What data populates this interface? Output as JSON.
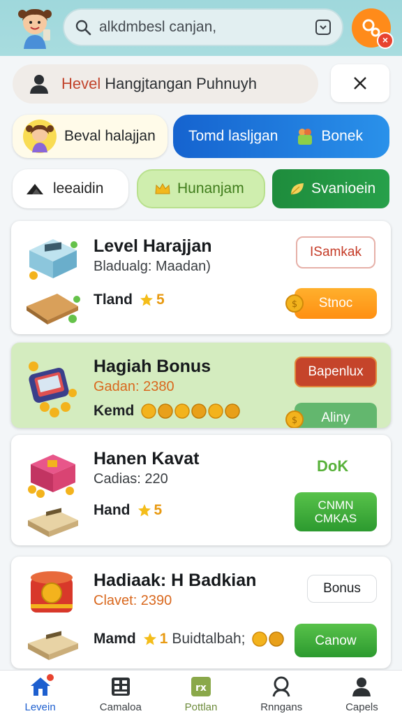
{
  "header": {
    "search_text": "alkdmbesl canjan,",
    "search_icon": "search-icon",
    "trail_icon": "tablet-icon",
    "fab_icon": "link-icon",
    "badge_icon": "close-icon"
  },
  "banner": {
    "title_highlight": "Hevel",
    "title_rest": "Hangjtangan Puhnuyh",
    "icon": "user-icon",
    "close_icon": "close-icon"
  },
  "chips": {
    "chip1": "Beval halajjan",
    "chip2": "Tomd lasljgan",
    "chip2_sub": "Bonek",
    "chip3": "leeaidin",
    "chip4": "Hunanjam",
    "chip5": "Svanioein"
  },
  "cards": [
    {
      "title": "Level Harajjan",
      "subtitle": "Bladualg: Maadan)",
      "meta_label": "Tland",
      "meta_value": "5",
      "button_top": "ISamkak",
      "button_bottom": "Stnoc"
    },
    {
      "title": "Hagiah Bonus",
      "subtitle": "Gadan: 2380",
      "meta_label": "Kemd",
      "button_top": "Bapenlux",
      "button_bottom": "Aliny"
    },
    {
      "title": "Hanen Kavat",
      "subtitle": "Cadias: 220",
      "meta_label": "Hand",
      "meta_value": "5",
      "button_top": "DoK",
      "button_bottom_line1": "CNMN",
      "button_bottom_line2": "CMKAS"
    },
    {
      "title": "Hadiaak: H Badkian",
      "subtitle": "Clavet: 2390",
      "meta_label": "Mamd",
      "meta_value": "1",
      "meta_extra": "Buidtalbah;",
      "button_top": "Bonus",
      "button_bottom": "Canow"
    }
  ],
  "nav": [
    {
      "label": "Levein",
      "icon": "home-icon"
    },
    {
      "label": "Camaloa",
      "icon": "grid-list-icon"
    },
    {
      "label": "Pottlan",
      "icon": "rx-icon"
    },
    {
      "label": "Rnngans",
      "icon": "search-person-icon"
    },
    {
      "label": "Capels",
      "icon": "profile-icon"
    }
  ],
  "colors": {
    "header_bg": "#a8dcdf",
    "accent_orange": "#ff8b1a",
    "accent_blue": "#1d5fcf",
    "accent_green": "#27a04a",
    "accent_red": "#c5442a"
  }
}
